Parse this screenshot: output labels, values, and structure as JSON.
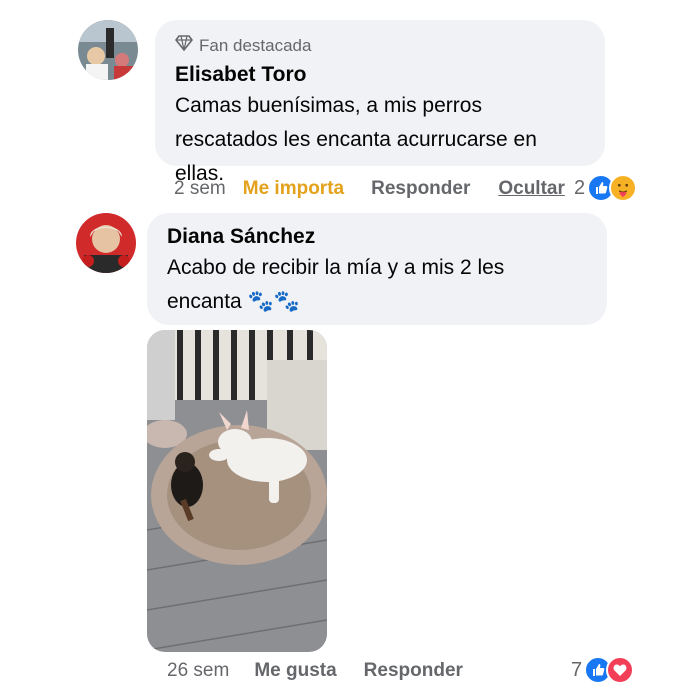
{
  "comments": [
    {
      "badge": "Fan destacada",
      "author": "Elisabet Toro",
      "text_line1": "Camas buenísimas, a mis perros",
      "text_line2": "rescatados les encanta acurrucarse en ellas.",
      "time": "2 sem",
      "like_label": "Me importa",
      "reply_label": "Responder",
      "hide_label": "Ocultar",
      "reaction_count": "2",
      "reaction_icons": [
        "like-icon",
        "care-icon"
      ]
    },
    {
      "author": "Diana Sánchez",
      "text_line1": "Acabo de recibir la mía y a mis 2 les",
      "text_line2": "encanta 🐾🐾",
      "time": "26 sem",
      "like_label": "Me gusta",
      "reply_label": "Responder",
      "reaction_count": "7",
      "reaction_icons": [
        "like-icon",
        "love-icon"
      ]
    }
  ],
  "colors": {
    "bubble": "#f0f2f5",
    "accent_importa": "#e4a11b",
    "like_blue": "#1877f2",
    "love_red": "#f33e58"
  }
}
